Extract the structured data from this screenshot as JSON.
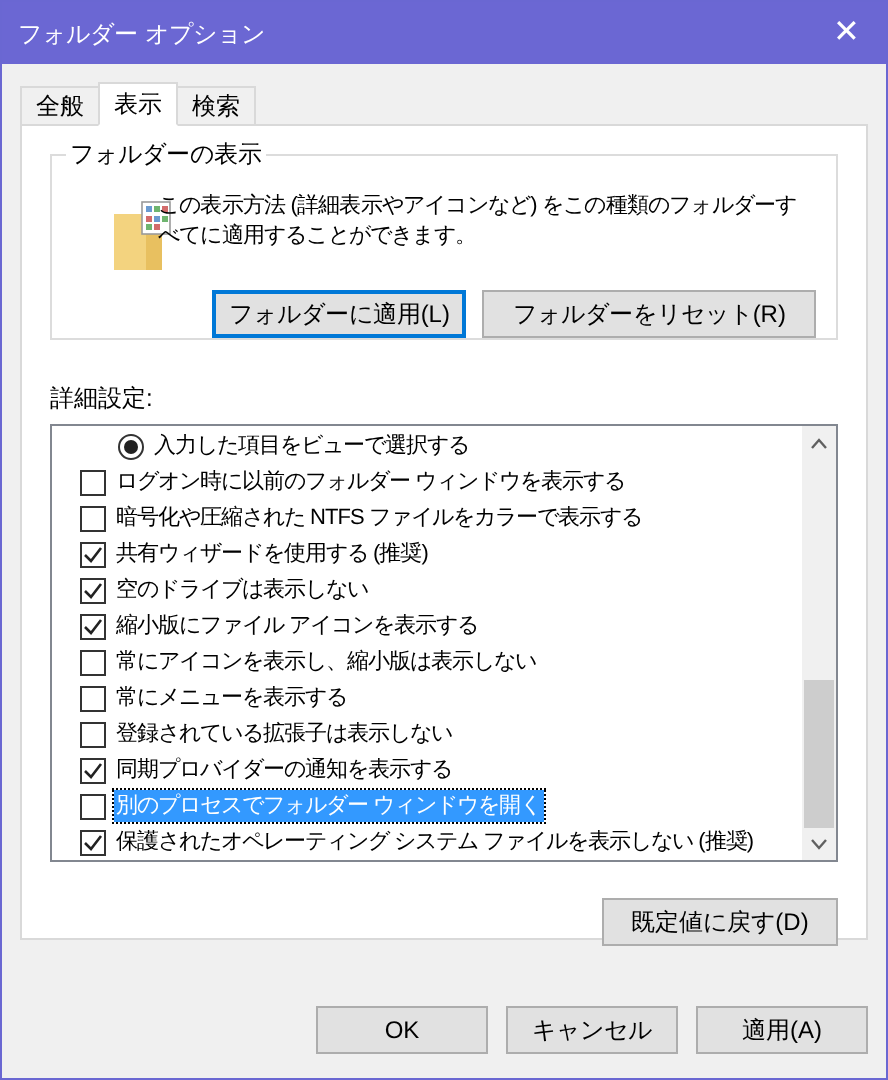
{
  "window": {
    "title": "フォルダー オプション",
    "close": "✕"
  },
  "tabs": [
    {
      "label": "全般",
      "selected": false
    },
    {
      "label": "表示",
      "selected": true
    },
    {
      "label": "検索",
      "selected": false
    }
  ],
  "folder_views": {
    "title": "フォルダーの表示",
    "description": "この表示方法 (詳細表示やアイコンなど) をこの種類のフォルダーすべてに適用することができます。",
    "buttons": [
      {
        "label": "フォルダーに適用(L)",
        "focused": true
      },
      {
        "label": "フォルダーをリセット(R)",
        "focused": false
      }
    ]
  },
  "advanced": {
    "label": "詳細設定:",
    "items": [
      {
        "kind": "radio",
        "label": "入力した項目をビューで選択する",
        "checked": true,
        "selected": false
      },
      {
        "kind": "checkbox",
        "label": "ログオン時に以前のフォルダー ウィンドウを表示する",
        "checked": false,
        "selected": false
      },
      {
        "kind": "checkbox",
        "label": "暗号化や圧縮された NTFS ファイルをカラーで表示する",
        "checked": false,
        "selected": false
      },
      {
        "kind": "checkbox",
        "label": "共有ウィザードを使用する (推奨)",
        "checked": true,
        "selected": false
      },
      {
        "kind": "checkbox",
        "label": "空のドライブは表示しない",
        "checked": true,
        "selected": false
      },
      {
        "kind": "checkbox",
        "label": "縮小版にファイル アイコンを表示する",
        "checked": true,
        "selected": false
      },
      {
        "kind": "checkbox",
        "label": "常にアイコンを表示し、縮小版は表示しない",
        "checked": false,
        "selected": false
      },
      {
        "kind": "checkbox",
        "label": "常にメニューを表示する",
        "checked": false,
        "selected": false
      },
      {
        "kind": "checkbox",
        "label": "登録されている拡張子は表示しない",
        "checked": false,
        "selected": false
      },
      {
        "kind": "checkbox",
        "label": "同期プロバイダーの通知を表示する",
        "checked": true,
        "selected": false
      },
      {
        "kind": "checkbox",
        "label": "別のプロセスでフォルダー ウィンドウを開く",
        "checked": false,
        "selected": true
      },
      {
        "kind": "checkbox",
        "label": "保護されたオペレーティング システム ファイルを表示しない (推奨)",
        "checked": true,
        "selected": false
      }
    ],
    "restore_button": "既定値に戻す(D)"
  },
  "buttons": [
    "OK",
    "キャンセル",
    "適用(A)"
  ]
}
